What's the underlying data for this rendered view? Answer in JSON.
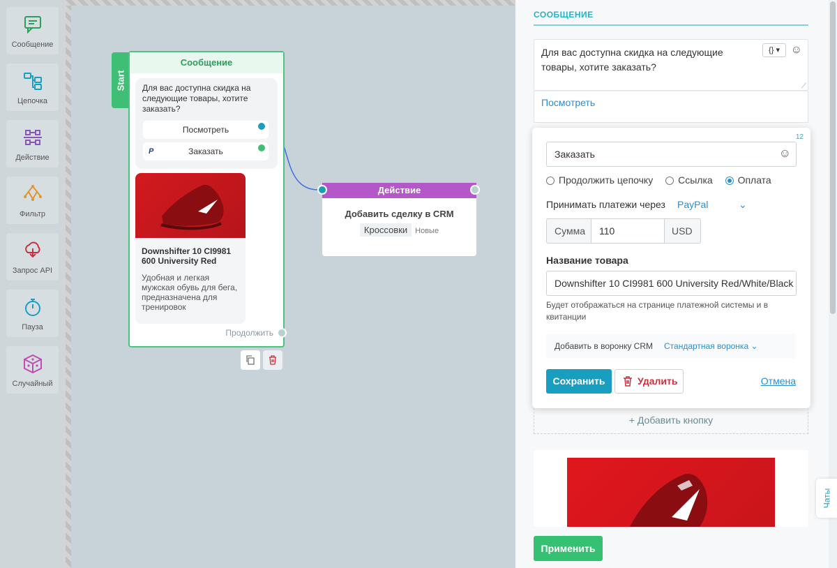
{
  "toolbar": {
    "items": [
      {
        "label": "Сообщение",
        "icon": "message-icon",
        "color": "#2e9c5a"
      },
      {
        "label": "Цепочка",
        "icon": "chain-icon",
        "color": "#1a9ebf"
      },
      {
        "label": "Действие",
        "icon": "action-icon",
        "color": "#8a55b8"
      },
      {
        "label": "Фильтр",
        "icon": "filter-icon",
        "color": "#e0962e"
      },
      {
        "label": "Запрос API",
        "icon": "api-icon",
        "color": "#c9303b"
      },
      {
        "label": "Пауза",
        "icon": "pause-icon",
        "color": "#1a9ebf"
      },
      {
        "label": "Случайный",
        "icon": "dice-icon",
        "color": "#c24bb0"
      }
    ]
  },
  "message_node": {
    "start_label": "Start",
    "title": "Сообщение",
    "text": "Для вас доступна скидка на следующие товары, хотите заказать?",
    "buttons": [
      "Посмотреть",
      "Заказать"
    ],
    "card": {
      "title": "Downshifter 10 CI9981 600 University Red",
      "description": "Удобная и легкая мужская обувь для бега, предназначена для тренировок"
    },
    "continue_label": "Продолжить"
  },
  "action_node": {
    "title": "Действие",
    "text": "Добавить сделку в CRM",
    "tag": "Кроссовки",
    "stage": "Новые"
  },
  "panel": {
    "title": "СООБЩЕНИЕ",
    "message_text": "Для вас доступна скидка на следующие товары, хотите заказать?",
    "var_button": "{}",
    "existing_button": "Посмотреть",
    "editor": {
      "counter": "12",
      "button_text": "Заказать",
      "options": [
        "Продолжить цепочку",
        "Ссылка",
        "Оплата"
      ],
      "selected_option": "Оплата",
      "payment_label": "Принимать платежи через",
      "payment_system": "PayPal",
      "sum_label": "Сумма",
      "sum_value": "110",
      "currency": "USD",
      "product_label": "Название товара",
      "product_name": "Downshifter 10 CI9981 600 University Red/White/Black",
      "product_hint": "Будет отображаться на странице платежной системы и в квитанции",
      "crm_label": "Добавить в воронку CRM",
      "crm_value": "Стандартная воронка",
      "save": "Сохранить",
      "delete": "Удалить",
      "cancel": "Отмена"
    },
    "add_button": "+ Добавить кнопку",
    "apply": "Применить",
    "chats": "Чаты"
  }
}
